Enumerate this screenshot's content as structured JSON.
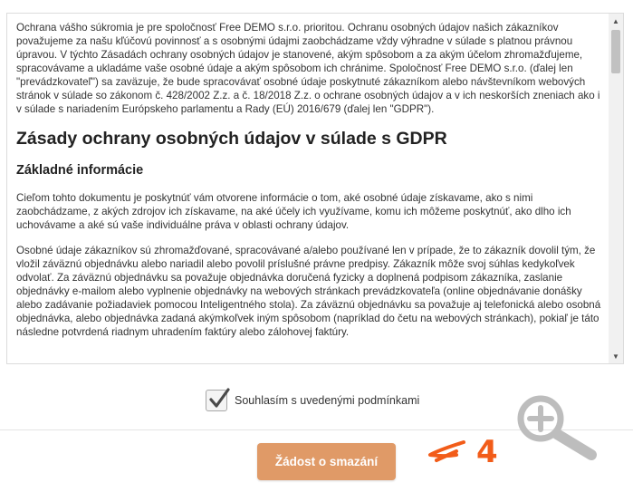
{
  "policy": {
    "intro": "Ochrana vášho súkromia je pre spoločnosť Free DEMO s.r.o. prioritou. Ochranu osobných údajov našich zákazníkov považujeme za našu kľúčovú povinnosť a s osobnými údajmi zaobchádzame vždy výhradne v súlade s platnou právnou úpravou. V týchto Zásadách ochrany osobných údajov je stanovené, akým spôsobom a za akým účelom zhromažďujeme, spracovávame a ukladáme vaše osobné údaje a akým spôsobom ich chránime. Spoločnosť Free DEMO s.r.o. (ďalej len \"prevádzkovateľ\") sa zaväzuje, že bude spracovávať osobné údaje poskytnuté zákazníkom alebo návštevníkom webových stránok v súlade so zákonom č. 428/2002 Z.z. a č. 18/2018 Z.z. o ochrane osobných údajov a v ich neskorších zneniach ako i v súlade s nariadením Európskeho parlamentu a Rady (EÚ) 2016/679 (ďalej len \"GDPR\").",
    "heading": "Zásady ochrany osobných údajov v súlade s GDPR",
    "subheading": "Základné informácie",
    "paragraph1": "Cieľom tohto dokumentu je poskytnúť vám otvorene informácie o tom, aké osobné údaje získavame, ako s nimi zaobchádzame, z akých zdrojov ich získavame, na aké účely ich využívame, komu ich môžeme poskytnúť, ako dlho ich uchovávame a aké sú vaše individuálne práva v oblasti ochrany údajov.",
    "paragraph2": "Osobné údaje zákazníkov sú zhromažďované, spracovávané a/alebo používané len v prípade, že to zákazník dovolil tým, že vložil záväznú objednávku alebo nariadil alebo povolil príslušné právne predpisy. Zákazník môže svoj súhlas kedykoľvek odvolať. Za záväznú objednávku sa považuje objednávka doručená fyzicky a doplnená podpisom zákazníka, zaslanie objednávky e-mailom alebo vyplnenie objednávky na webových stránkach prevádzkovateľa (online objednávanie donášky alebo zadávanie požiadaviek pomocou Inteligentného stola). Za záväznú objednávku sa považuje aj telefonická alebo osobná objednávka, alebo objednávka zadaná akýmkoľvek iným spôsobom (napríklad do četu na webových stránkach), pokiaľ je táto následne potvrdená riadnym uhradením faktúry alebo zálohovej faktúry."
  },
  "consent": {
    "label": "Souhlasím s uvedenými podmínkami",
    "checked": true
  },
  "action": {
    "delete_label": "Žádost o smazání"
  },
  "annotation": {
    "text": "4",
    "color": "#f25c19"
  },
  "colors": {
    "button": "#e09a67",
    "zoom_icon": "#bdbdbd"
  }
}
